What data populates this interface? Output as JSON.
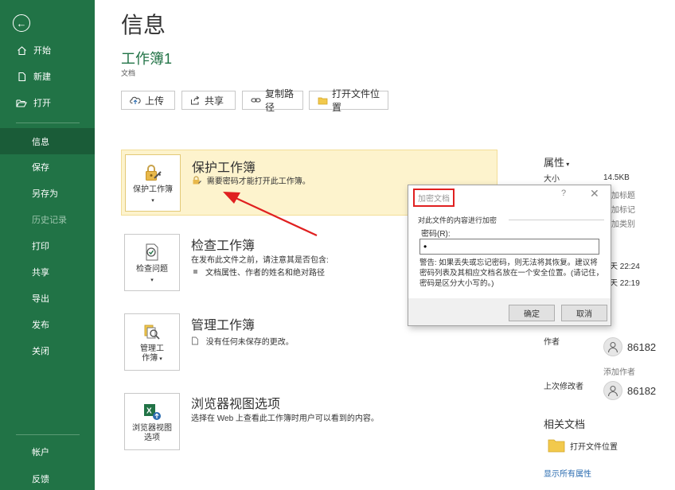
{
  "sidebar": {
    "back": "⊖",
    "items": [
      {
        "label": "开始"
      },
      {
        "label": "新建"
      },
      {
        "label": "打开"
      },
      {
        "label": "信息"
      },
      {
        "label": "保存"
      },
      {
        "label": "另存为"
      },
      {
        "label": "历史记录"
      },
      {
        "label": "打印"
      },
      {
        "label": "共享"
      },
      {
        "label": "导出"
      },
      {
        "label": "发布"
      },
      {
        "label": "关闭"
      },
      {
        "label": "帐户"
      },
      {
        "label": "反馈"
      }
    ]
  },
  "main": {
    "title": "信息",
    "workbook_name": "工作簿1",
    "workbook_sub": "文档",
    "buttons": {
      "upload": "上传",
      "share": "共享",
      "copy_path": "复制路径",
      "open_location": "打开文件位置"
    },
    "sections": {
      "protect": {
        "tile_label": "保护工作簿",
        "title": "保护工作簿",
        "desc": "需要密码才能打开此工作簿。"
      },
      "inspect": {
        "tile_label": "检查问题",
        "title": "检查工作簿",
        "desc": "在发布此文件之前，请注意其是否包含:",
        "bullet": "文档属性、作者的姓名和绝对路径"
      },
      "manage": {
        "tile_label_1": "管理工",
        "tile_label_2": "作簿",
        "title": "管理工作簿",
        "desc": "没有任何未保存的更改。"
      },
      "browser": {
        "tile_label_1": "浏览器视图",
        "tile_label_2": "选项",
        "title": "浏览器视图选项",
        "desc": "选择在 Web 上查看此工作簿时用户可以看到的内容。"
      }
    }
  },
  "properties": {
    "title": "属性",
    "size_label": "大小",
    "size_value": "14.5KB",
    "add_title": "加标题",
    "add_tag": "加标记",
    "add_category": "加类别",
    "time1": "天 22:24",
    "time2": "天 22:19",
    "author_label": "作者",
    "author_name": "86182",
    "add_author": "添加作者",
    "last_modified_label": "上次修改者",
    "last_modified_name": "86182",
    "related_title": "相关文档",
    "open_location": "打开文件位置",
    "show_all": "显示所有属性"
  },
  "dialog": {
    "title": "加密文档",
    "help": "?",
    "close": "✕",
    "group_label": "对此文件的内容进行加密",
    "pwd_label": "密码(R):",
    "pwd_value": "•",
    "warning": "警告: 如果丢失或忘记密码，则无法将其恢复。建议将密码列表及其相应文档名放在一个安全位置。(请记住，密码是区分大小写的。)",
    "ok": "确定",
    "cancel": "取消"
  },
  "colors": {
    "sidebar": "#217346",
    "selected": "#1a5c38",
    "highlight": "#fdf3cd",
    "arrow": "#e02020"
  }
}
